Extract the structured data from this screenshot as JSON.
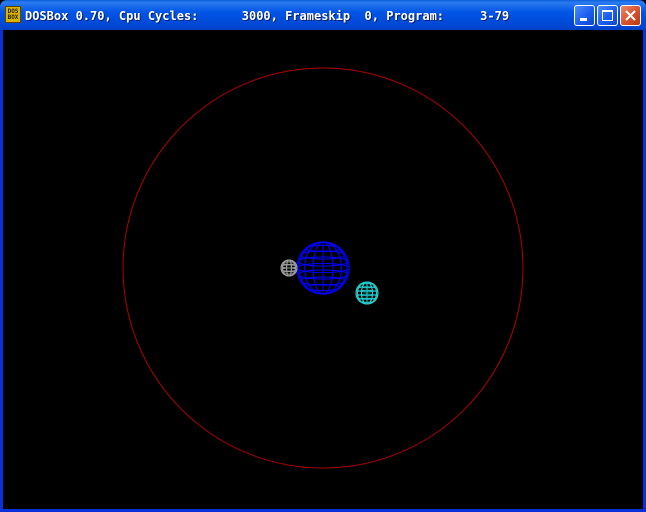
{
  "window": {
    "title": "DOSBox 0.70, Cpu Cycles:      3000, Frameskip  0, Program:     3-79",
    "icon": "dosbox-icon",
    "icon_text_line1": "DOS",
    "icon_text_line2": "BOX",
    "controls": {
      "minimize": "minimize-icon",
      "maximize": "maximize-icon",
      "close": "close-icon"
    }
  },
  "scene": {
    "background": "#000000",
    "orbit_color": "#b00000",
    "planet_color": "#0000ff",
    "moon_gray_color": "#9a9a9a",
    "moon_cyan_color": "#22cccc"
  }
}
